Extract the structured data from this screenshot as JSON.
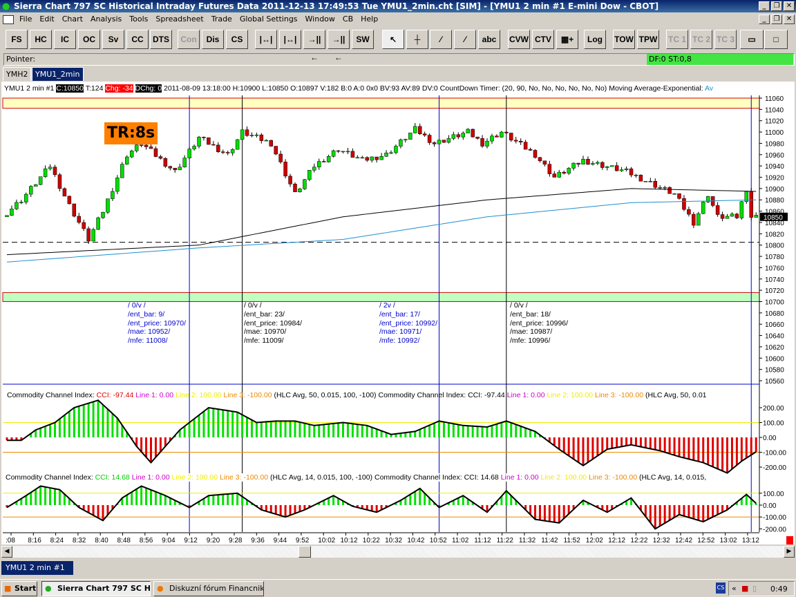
{
  "window": {
    "title": "Sierra Chart 797 SC Historical Intraday Futures Data 2011-12-13  17:49:53 Tue  YMU1_2min.cht [SIM] - [YMU1  2 min   #1  E-mini Dow - CBOT]"
  },
  "menu": [
    "File",
    "Edit",
    "Chart",
    "Analysis",
    "Tools",
    "Spreadsheet",
    "Trade",
    "Global Settings",
    "Window",
    "CB",
    "Help"
  ],
  "toolbar": [
    "FS",
    "HC",
    "IC",
    "OC",
    "Sv",
    "CC",
    "DTS",
    "Con",
    "Dis",
    "CS",
    "|↔|",
    "|↔|",
    "→||←",
    "→||←",
    "SW",
    "↖",
    "┼",
    "⁄",
    "⁄",
    "abc",
    "CVW",
    "CTV",
    "▦+",
    "Log",
    "TOW",
    "TPW",
    "TC 1",
    "TC 2",
    "TC 3",
    "▭",
    "□"
  ],
  "pointer_label": "Pointer:",
  "status": "DF:0  ST:0,8",
  "tabs": [
    "YMH2",
    "YMU1_2min"
  ],
  "info": {
    "symbol": "YMU1  2 min   #1",
    "close": "C:10850",
    "ticks": "T:124",
    "chg": "Chg: -34",
    "dchg": "DChg: 0",
    "rest": "2011-08-09 13:18:00 H:10900 L:10850 O:10897 V:182 B:0 A:0 0x0 BV:93 AV:89 DV:0 CountDown Timer:   (20, 90, No, No, No, No, No, No)  Moving Average-Exponential:",
    "av": "Av"
  },
  "tr_label": "TR:8s",
  "annotations": [
    {
      "lines": [
        "/ 0/v /",
        "/ent_bar: 9/",
        "/ent_price: 10970/",
        "/mae: 10952/",
        "/mfe: 11008/"
      ],
      "color": "#0000cc"
    },
    {
      "lines": [
        "/ 0/v /",
        "/ent_bar: 23/",
        "/ent_price: 10984/",
        "/mae: 10970/",
        "/mfe: 11009/"
      ],
      "color": "#000000"
    },
    {
      "lines": [
        "/ 2v /",
        "/ent_bar: 17/",
        "/ent_price: 10992/",
        "/mae: 10971/",
        "/mfe: 10992/"
      ],
      "color": "#0000cc"
    },
    {
      "lines": [
        "/ 0/v /",
        "/ent_bar: 18/",
        "/ent_price: 10996/",
        "/mae: 10987/",
        "/mfe: 10996/"
      ],
      "color": "#000000"
    }
  ],
  "cci1": {
    "name": "Commodity Channel Index:",
    "cci": "CCI: -97.44",
    "l1": "Line 1: 0.00",
    "l2": "Line 2: 100.00",
    "l3": "Line 3: -100.00",
    "params": "(HLC Avg, 50, 0.015, 100, -100)",
    "name2": "Commodity Channel Index:",
    "cci2": "CCI: -97.44",
    "params2": "(HLC Avg, 50, 0.01"
  },
  "cci2": {
    "name": "Commodity Channel Index:",
    "cci": "CCI: 14.68",
    "l1": "Line 1: 0.00",
    "l2": "Line 2: 100.00",
    "l3": "Line 3: -100.00",
    "params": "(HLC Avg, 14, 0.015, 100, -100)",
    "name2": "Commodity Channel Index:",
    "cci2": "CCI: 14.68",
    "params2": "(HLC Avg, 14, 0.015,"
  },
  "current_price": "10850",
  "bottom_tab": "YMU1  2 min   #1",
  "taskbar": {
    "start": "Start",
    "tasks": [
      "Sierra Chart 797 SC Hi...",
      "Diskuzní fórum Financnik...."
    ],
    "clock": "0:49"
  },
  "colors": {
    "up": "#00dd00",
    "down": "#cc0000",
    "ema1": "#000000",
    "ema2": "#1e8fd0",
    "band_top": "#ffffc0",
    "band_bottom": "#c0ffc0"
  },
  "chart_data": {
    "type": "candlestick",
    "bars": 157,
    "price_axis": {
      "min": 10560,
      "max": 11060,
      "step": 20
    },
    "price_path": [
      [
        0,
        10850
      ],
      [
        4,
        10880
      ],
      [
        10,
        10940
      ],
      [
        14,
        10870
      ],
      [
        18,
        10810
      ],
      [
        21,
        10860
      ],
      [
        26,
        10960
      ],
      [
        29,
        10980
      ],
      [
        36,
        10930
      ],
      [
        41,
        10990
      ],
      [
        47,
        10960
      ],
      [
        50,
        11000
      ],
      [
        56,
        10980
      ],
      [
        61,
        10890
      ],
      [
        65,
        10940
      ],
      [
        70,
        10970
      ],
      [
        75,
        10950
      ],
      [
        80,
        10960
      ],
      [
        86,
        11005
      ],
      [
        90,
        10980
      ],
      [
        97,
        11000
      ],
      [
        100,
        10980
      ],
      [
        104,
        11000
      ],
      [
        111,
        10960
      ],
      [
        115,
        10920
      ],
      [
        121,
        10950
      ],
      [
        130,
        10930
      ],
      [
        135,
        10910
      ],
      [
        140,
        10890
      ],
      [
        144,
        10840
      ],
      [
        147,
        10890
      ],
      [
        149,
        10850
      ],
      [
        153,
        10850
      ],
      [
        155,
        10900
      ],
      [
        156,
        10850
      ]
    ],
    "ema_long": [
      [
        0,
        10783
      ],
      [
        40,
        10800
      ],
      [
        70,
        10850
      ],
      [
        100,
        10880
      ],
      [
        130,
        10900
      ],
      [
        156,
        10895
      ]
    ],
    "ema_short": [
      [
        0,
        10770
      ],
      [
        40,
        10795
      ],
      [
        70,
        10810
      ],
      [
        100,
        10850
      ],
      [
        130,
        10875
      ],
      [
        156,
        10880
      ]
    ],
    "dashed_level": 10805,
    "bands": [
      [
        11042,
        11060
      ],
      [
        10700,
        10716
      ]
    ],
    "entry_lines": [
      {
        "bar": 38,
        "color": "#0000cc"
      },
      {
        "bar": 49,
        "color": "#000000"
      },
      {
        "bar": 90,
        "color": "#0000cc"
      },
      {
        "bar": 104,
        "color": "#000000"
      },
      {
        "bar": 155,
        "color": "#0000cc"
      }
    ],
    "cci50": [
      [
        0,
        -20
      ],
      [
        3,
        -20
      ],
      [
        6,
        50
      ],
      [
        10,
        100
      ],
      [
        14,
        200
      ],
      [
        19,
        250
      ],
      [
        23,
        130
      ],
      [
        27,
        -60
      ],
      [
        30,
        -170
      ],
      [
        33,
        -60
      ],
      [
        36,
        50
      ],
      [
        42,
        200
      ],
      [
        48,
        170
      ],
      [
        52,
        100
      ],
      [
        56,
        110
      ],
      [
        60,
        110
      ],
      [
        64,
        80
      ],
      [
        70,
        100
      ],
      [
        75,
        80
      ],
      [
        80,
        20
      ],
      [
        85,
        40
      ],
      [
        90,
        110
      ],
      [
        95,
        80
      ],
      [
        100,
        70
      ],
      [
        104,
        110
      ],
      [
        110,
        40
      ],
      [
        115,
        -80
      ],
      [
        120,
        -190
      ],
      [
        125,
        -80
      ],
      [
        130,
        -50
      ],
      [
        136,
        -90
      ],
      [
        140,
        -130
      ],
      [
        145,
        -170
      ],
      [
        150,
        -240
      ],
      [
        153,
        -160
      ],
      [
        156,
        -97
      ]
    ],
    "cci14": [
      [
        0,
        -20
      ],
      [
        4,
        80
      ],
      [
        7,
        160
      ],
      [
        11,
        130
      ],
      [
        15,
        -20
      ],
      [
        20,
        -130
      ],
      [
        24,
        60
      ],
      [
        28,
        160
      ],
      [
        33,
        80
      ],
      [
        38,
        -20
      ],
      [
        42,
        80
      ],
      [
        48,
        100
      ],
      [
        53,
        -40
      ],
      [
        58,
        -100
      ],
      [
        62,
        -40
      ],
      [
        68,
        80
      ],
      [
        72,
        -10
      ],
      [
        77,
        -60
      ],
      [
        82,
        40
      ],
      [
        86,
        140
      ],
      [
        90,
        -20
      ],
      [
        95,
        80
      ],
      [
        100,
        -60
      ],
      [
        104,
        120
      ],
      [
        110,
        -120
      ],
      [
        115,
        -150
      ],
      [
        120,
        40
      ],
      [
        125,
        -60
      ],
      [
        130,
        60
      ],
      [
        135,
        -200
      ],
      [
        140,
        -80
      ],
      [
        145,
        -140
      ],
      [
        150,
        -40
      ],
      [
        154,
        90
      ],
      [
        156,
        14.68
      ]
    ],
    "cci_axis": [
      "200.00",
      "100.00",
      "0.00",
      "-100.00",
      "-200.00"
    ],
    "time_labels": [
      ":08",
      "8:16",
      "8:24",
      "8:32",
      "8:40",
      "8:48",
      "8:56",
      "9:04",
      "9:12",
      "9:20",
      "9:28",
      "9:36",
      "9:44",
      "9:52",
      "10:02",
      "10:12",
      "10:22",
      "10:32",
      "10:42",
      "10:52",
      "11:02",
      "11:12",
      "11:22",
      "11:32",
      "11:42",
      "11:52",
      "12:02",
      "12:12",
      "12:22",
      "12:32",
      "12:42",
      "12:52",
      "13:02",
      "13:12"
    ]
  }
}
